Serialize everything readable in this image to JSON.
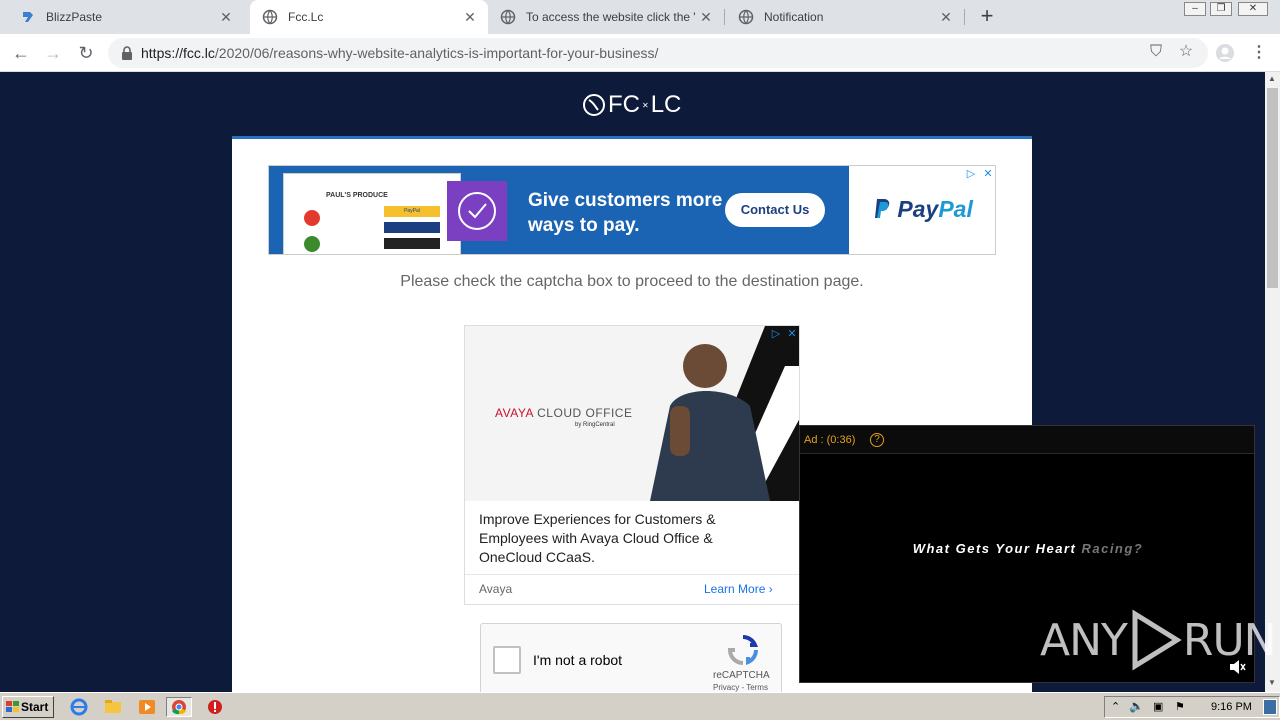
{
  "browser": {
    "tabs": [
      {
        "title": "BlizzPaste",
        "active": false,
        "favicon": "blizzpaste-icon"
      },
      {
        "title": "Fcc.Lc",
        "active": true,
        "favicon": "globe-icon"
      },
      {
        "title": "To access the website click the \"Allow\"",
        "active": false,
        "favicon": "globe-icon"
      },
      {
        "title": "Notification",
        "active": false,
        "favicon": "globe-icon"
      }
    ],
    "url_host": "https://fcc.lc",
    "url_path": "/2020/06/reasons-why-website-analytics-is-important-for-your-business/"
  },
  "page": {
    "logo_text": "FC",
    "logo_text_2": "LC",
    "logo_dot": "✕",
    "message": "Please check the captcha box to proceed to the destination page."
  },
  "paypal_ad": {
    "mock_title": "PAUL'S PRODUCE",
    "mock_btn1": "PayPal",
    "headline": "Give customers more ways to pay.",
    "cta": "Contact Us",
    "brand_a": "Pay",
    "brand_b": "Pal"
  },
  "avaya_ad": {
    "brand": "AVAYA",
    "brand_suffix": "CLOUD OFFICE",
    "brand_by": "by RingCentral",
    "text": "Improve Experiences for Customers & Employees with Avaya Cloud Office & OneCloud CCaaS.",
    "advertiser": "Avaya",
    "cta": "Learn More"
  },
  "captcha": {
    "label": "I'm not a robot",
    "name": "reCAPTCHA",
    "terms": "Privacy - Terms"
  },
  "video_ad": {
    "timer": "Ad : (0:36)",
    "help": "?",
    "tagline_a": "What Gets Your Heart ",
    "tagline_b": "Racing?"
  },
  "watermark": {
    "text_a": "ANY",
    "text_b": "RUN"
  },
  "taskbar": {
    "start": "Start",
    "clock": "9:16 PM"
  },
  "colors": {
    "page_bg": "#0e1a3a",
    "paypal_blue": "#1b64b3",
    "paypal_purple": "#7b3fc2",
    "card_accent": "#2a70c0",
    "video_accent": "#e5a021"
  }
}
